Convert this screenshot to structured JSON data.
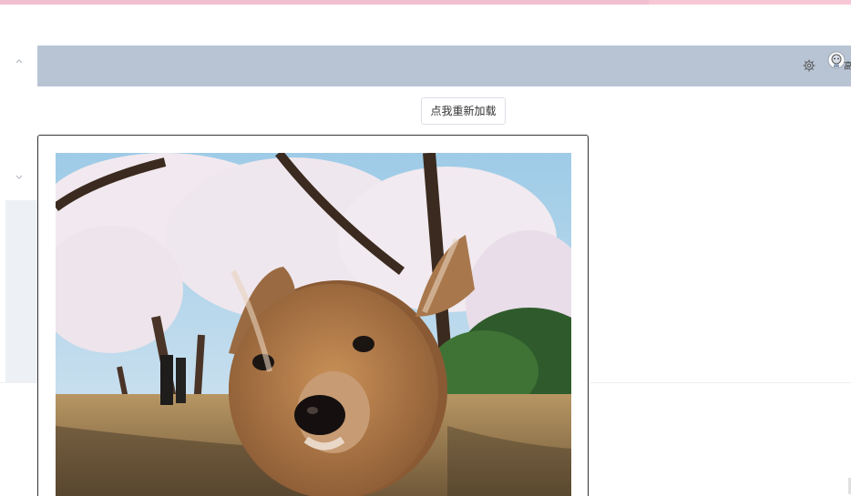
{
  "top_progress": {
    "accent": "#f2bfd0"
  },
  "left_rail": {
    "collapse_icon": "chevron-up-icon",
    "expand_icon": "chevron-down-icon"
  },
  "header": {
    "background": "#b8c4d4",
    "settings_icon": "gear-icon",
    "avatar_icon": "avatar-icon",
    "truncated_text": "高"
  },
  "main": {
    "reload_button_label": "点我重新加载"
  },
  "image_panel": {
    "image_subject": "deer-under-cherry-blossoms",
    "border_color": "#333333"
  }
}
